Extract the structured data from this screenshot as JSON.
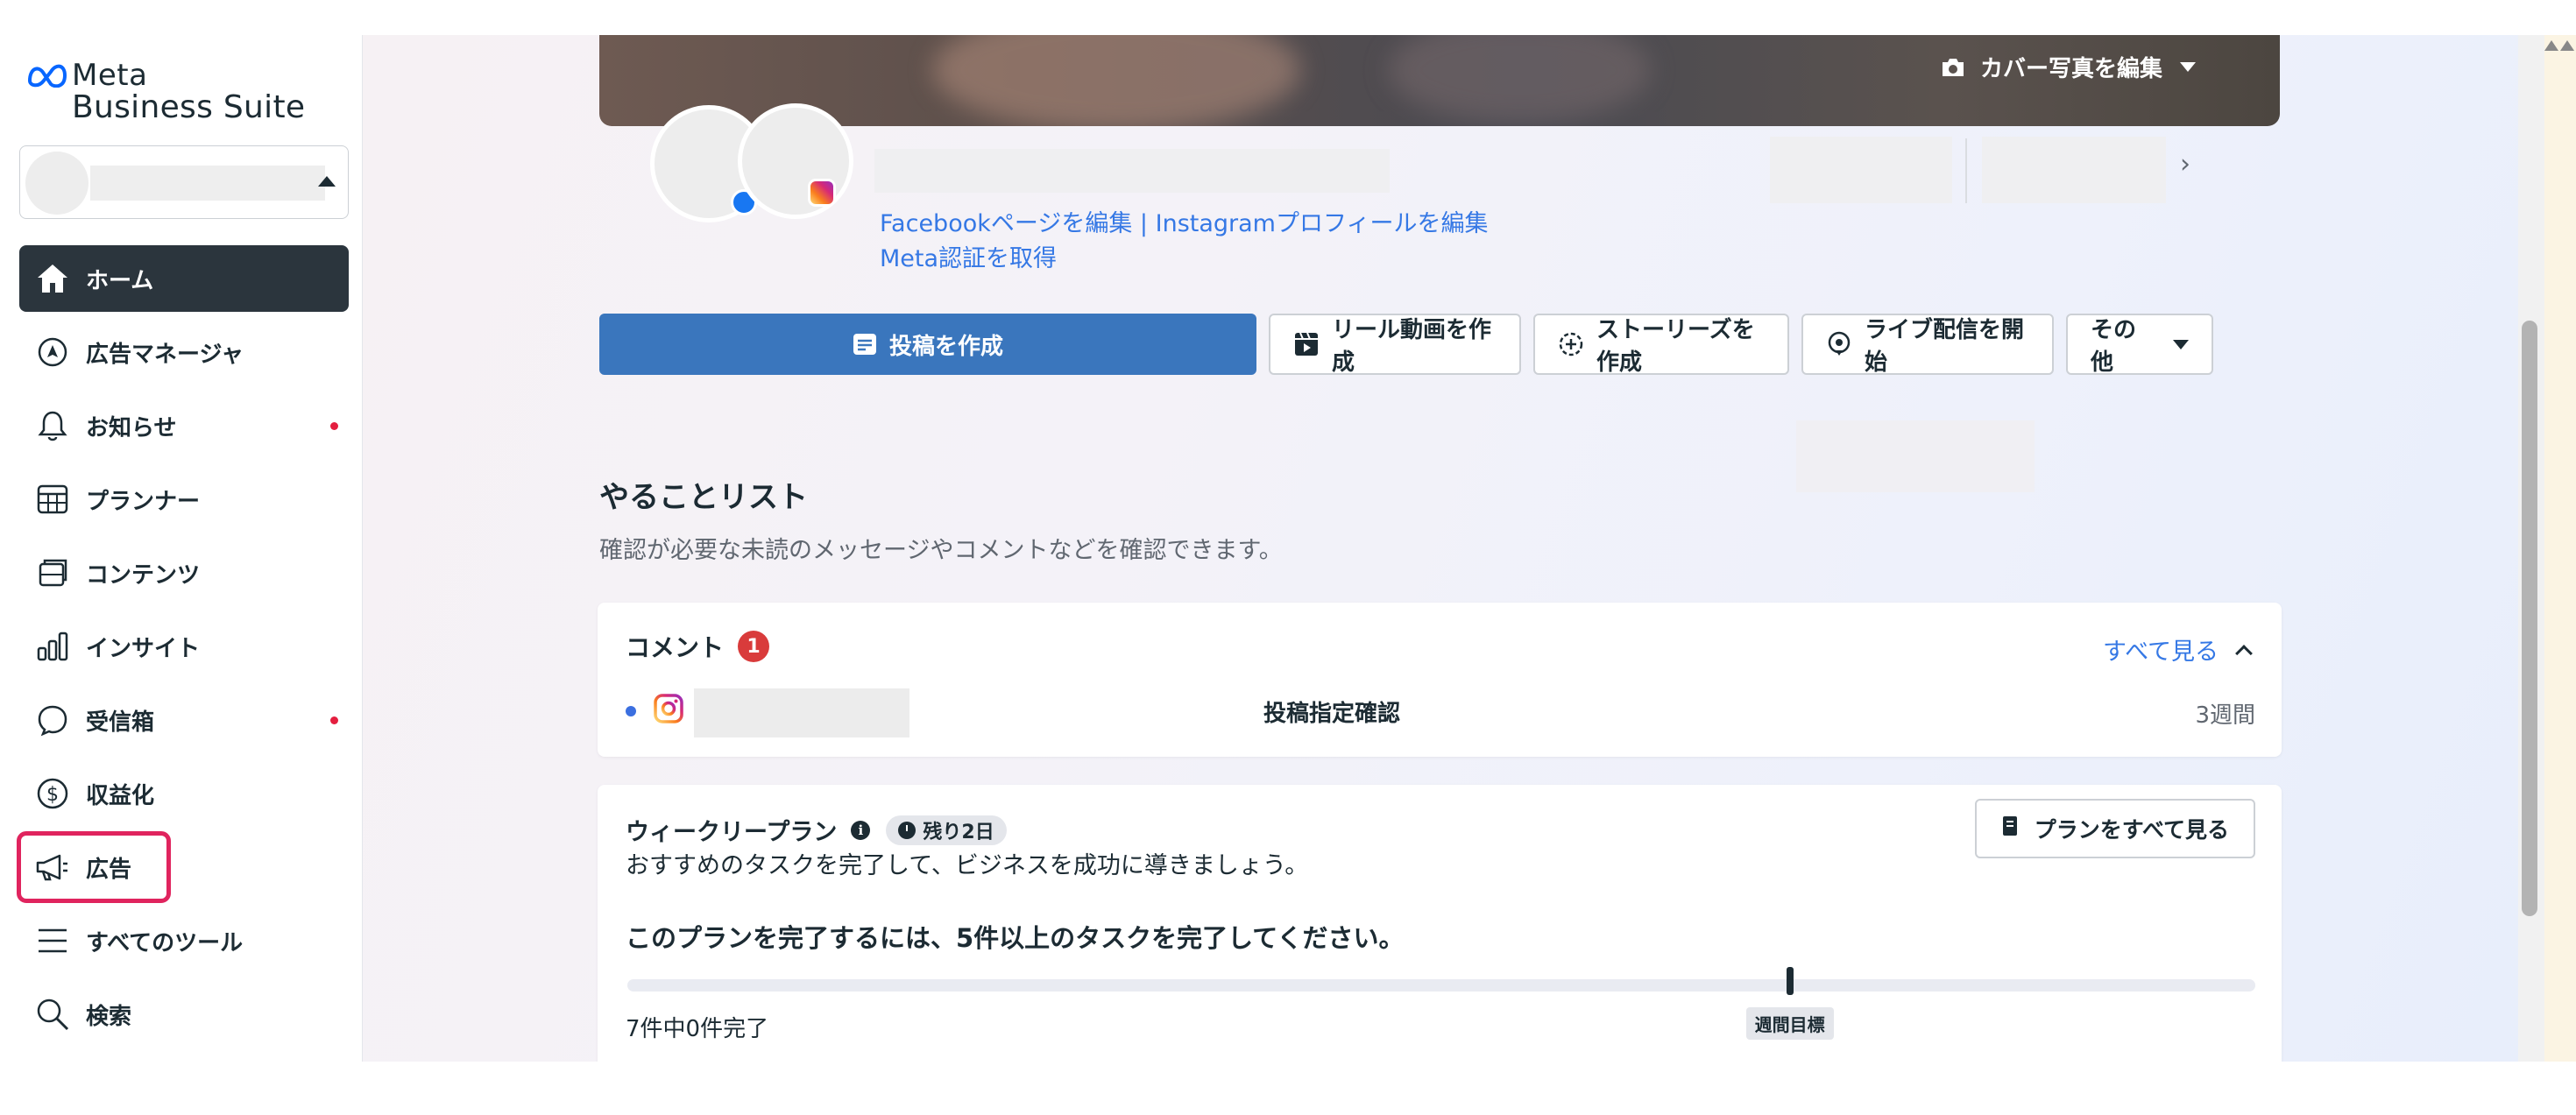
{
  "app": {
    "brand_line1": "Meta",
    "brand_line2": "Business Suite"
  },
  "sidebar": {
    "items": [
      {
        "label": "ホーム",
        "icon": "home-icon",
        "active": true
      },
      {
        "label": "広告マネージャ",
        "icon": "ads-manager-icon"
      },
      {
        "label": "お知らせ",
        "icon": "bell-icon",
        "dot": true
      },
      {
        "label": "プランナー",
        "icon": "planner-icon"
      },
      {
        "label": "コンテンツ",
        "icon": "content-icon"
      },
      {
        "label": "インサイト",
        "icon": "insights-icon"
      },
      {
        "label": "受信箱",
        "icon": "inbox-icon",
        "dot": true
      },
      {
        "label": "収益化",
        "icon": "monetization-icon"
      },
      {
        "label": "広告",
        "icon": "megaphone-icon",
        "highlight": true
      },
      {
        "label": "すべてのツール",
        "icon": "menu-icon"
      },
      {
        "label": "検索",
        "icon": "search-icon"
      }
    ]
  },
  "header": {
    "cover_edit_label": "カバー写真を編集",
    "links": {
      "edit_facebook": "Facebookページを編集",
      "separator": "|",
      "edit_instagram": "Instagramプロフィールを編集",
      "get_verified": "Meta認証を取得"
    }
  },
  "actions": {
    "create_post": "投稿を作成",
    "create_reel": "リール動画を作成",
    "create_story": "ストーリーズを作成",
    "go_live": "ライブ配信を開始",
    "more": "その他"
  },
  "todo": {
    "title": "やることリスト",
    "subtitle": "確認が必要な未読のメッセージやコメントなどを確認できます。"
  },
  "comments": {
    "title": "コメント",
    "count": "1",
    "see_all": "すべて見る",
    "row": {
      "text": "投稿指定確認",
      "time": "3週間"
    }
  },
  "weekly_plan": {
    "title": "ウィークリープラン",
    "info": "i",
    "badge": "残り2日",
    "subtitle": "おすすめのタスクを完了して、ビジネスを成功に導きましょう。",
    "see_all_button": "プランをすべて見る",
    "cta": "このプランを完了するには、5件以上のタスクを完了してください。",
    "progress_text": "7件中0件完了",
    "goal_label": "週間目標",
    "progress_fraction": 0,
    "goal_fraction": 0.714
  },
  "colors": {
    "accent": "#3a76bd",
    "link": "#3578e5",
    "active_nav": "#2b353d",
    "highlight_border": "#e0245e",
    "notification_dot": "#e41e3f",
    "count_badge": "#d93b3b"
  }
}
